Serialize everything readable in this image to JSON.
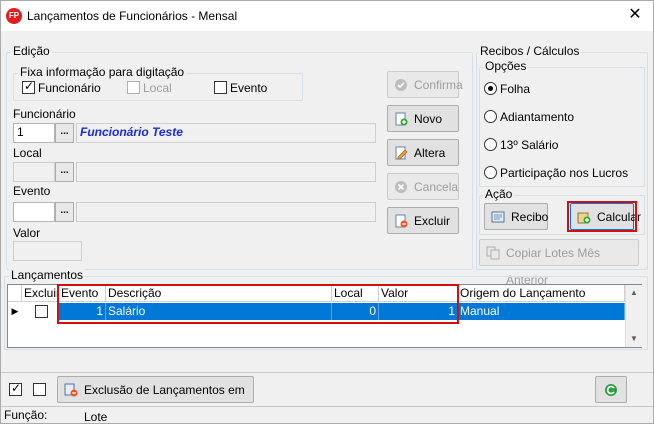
{
  "window": {
    "title": "Lançamentos de Funcionários - Mensal",
    "app_badge": "FP",
    "close_glyph": "✕"
  },
  "edicao": {
    "label": "Edição",
    "fixa": {
      "label": "Fixa informação para digitação",
      "funcionario": {
        "label": "Funcionário",
        "checked": true
      },
      "local": {
        "label": "Local",
        "checked": false,
        "enabled": false
      },
      "evento": {
        "label": "Evento",
        "checked": false
      }
    },
    "funcionario": {
      "label": "Funcionário",
      "code": "1",
      "name": "Funcionário Teste"
    },
    "local": {
      "label": "Local",
      "code": "",
      "name": ""
    },
    "evento": {
      "label": "Evento",
      "code": "",
      "name": ""
    },
    "valor": {
      "label": "Valor",
      "value": ""
    },
    "ellipsis": "..."
  },
  "actions": {
    "confirma": "Confirma",
    "novo": "Novo",
    "altera": "Altera",
    "cancela": "Cancela",
    "excluir": "Excluir"
  },
  "recibos": {
    "label": "Recibos / Cálculos",
    "opcoes": {
      "label": "Opções",
      "items": [
        "Folha",
        "Adiantamento",
        "13º Salário",
        "Participação nos Lucros"
      ],
      "selected": "Folha"
    },
    "acao": {
      "label": "Ação",
      "recibo": "Recibo",
      "calcular": "Calcular"
    },
    "copiar": "Copiar Lotes Mês Anterior"
  },
  "lancamentos": {
    "label": "Lançamentos",
    "columns": [
      "Excluir",
      "Evento",
      "Descrição",
      "Local",
      "Valor",
      "Origem do Lançamento"
    ],
    "rows": [
      {
        "excluir": false,
        "evento": "1",
        "descricao": "Salário",
        "local": "0",
        "valor": "1",
        "origem": "Manual"
      }
    ]
  },
  "footer": {
    "check1": true,
    "check2": false,
    "exclusao_lote": "Exclusão de Lançamentos em Lote",
    "funcao_label": "Função:"
  },
  "icons": [
    "check-circle-icon",
    "new-doc-icon",
    "edit-doc-icon",
    "cancel-icon",
    "delete-doc-icon",
    "receipt-icon",
    "calculator-icon",
    "copy-icon",
    "batch-delete-icon",
    "refresh-icon"
  ],
  "colors": {
    "selection": "#0078d7",
    "name_text": "#1a2bd6",
    "highlight_box": "#d01010"
  }
}
